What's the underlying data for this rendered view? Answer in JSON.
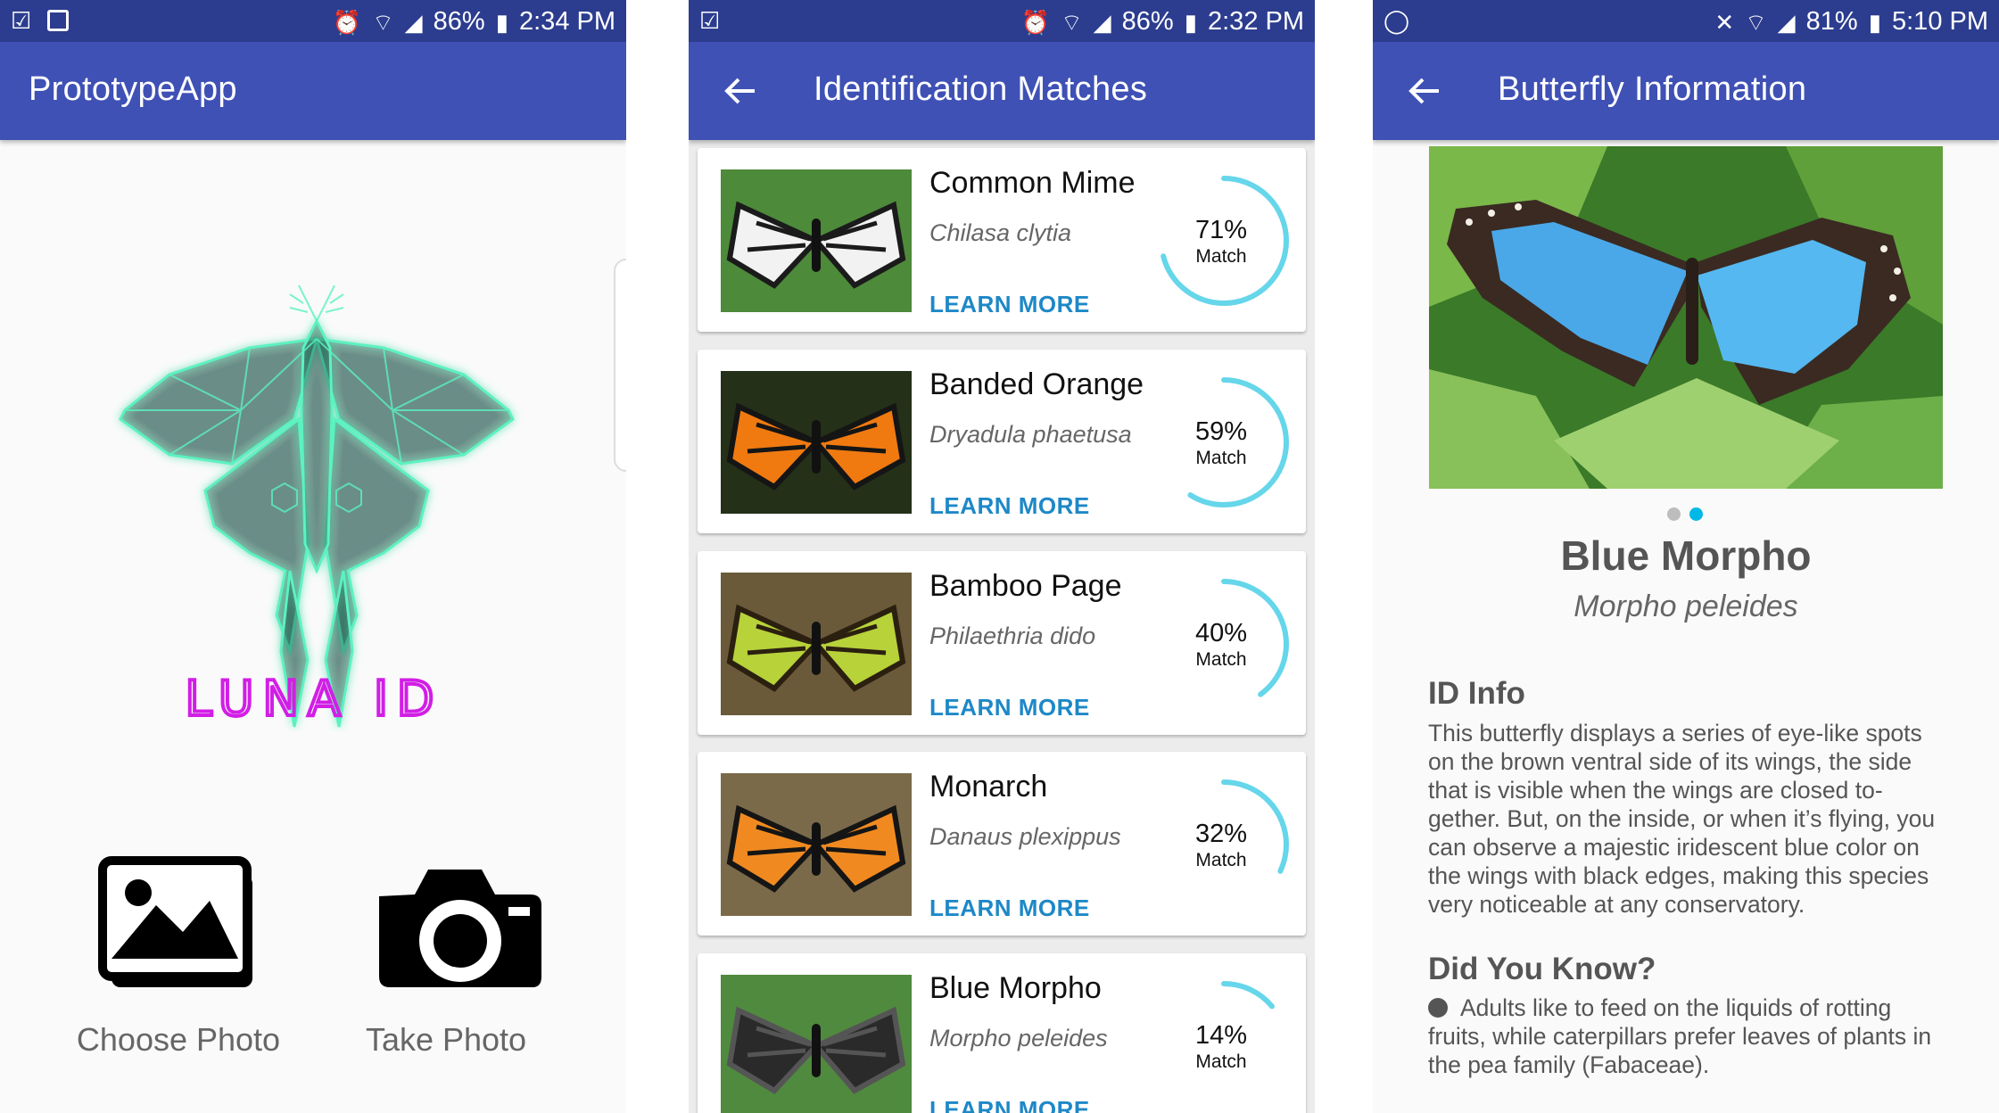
{
  "colors": {
    "statusbar": "#2c3d8f",
    "appbar": "#3f51b5",
    "accent": "#1e88c7",
    "ring": "#66d6ea",
    "logo": "#5cf2c0",
    "logo_text": "#d21ee6"
  },
  "panel1": {
    "status": {
      "battery": "86%",
      "time": "2:34 PM"
    },
    "title": "PrototypeApp",
    "logo_text": "LUNA ID",
    "choose_label": "Choose Photo",
    "take_label": "Take Photo"
  },
  "panel2": {
    "status": {
      "battery": "86%",
      "time": "2:32 PM"
    },
    "title": "Identification Matches",
    "matches": [
      {
        "name": "Common Mime",
        "scientific": "Chilasa clytia",
        "percent": "71%",
        "percent_value": 0.71,
        "match": "Match",
        "learn": "LEARN MORE"
      },
      {
        "name": "Banded Orange",
        "scientific": "Dryadula phaetusa",
        "percent": "59%",
        "percent_value": 0.59,
        "match": "Match",
        "learn": "LEARN MORE"
      },
      {
        "name": "Bamboo Page",
        "scientific": "Philaethria dido",
        "percent": "40%",
        "percent_value": 0.4,
        "match": "Match",
        "learn": "LEARN MORE"
      },
      {
        "name": "Monarch",
        "scientific": "Danaus plexippus",
        "percent": "32%",
        "percent_value": 0.32,
        "match": "Match",
        "learn": "LEARN MORE"
      },
      {
        "name": "Blue Morpho",
        "scientific": "Morpho peleides",
        "percent": "14%",
        "percent_value": 0.14,
        "match": "Match",
        "learn": "LEARN MORE"
      }
    ]
  },
  "panel3": {
    "status": {
      "battery": "81%",
      "time": "5:10 PM"
    },
    "title": "Butterfly Information",
    "name": "Blue Morpho",
    "scientific": "Morpho peleides",
    "id_info_heading": "ID Info",
    "id_info_text": "This butterfly displays a series of eye-like spots on the brown ventral side of its wings, the side that is visible when the wings are closed to-gether. But, on the inside, or when it’s flying, you can observe a majestic iridescent blue color on the wings with black edges, making this species very noticeable at any conservatory.",
    "did_you_know_heading": "Did You Know?",
    "facts": [
      "Adults like to feed on the liquids of rotting fruits, while caterpillars prefer leaves of plants in the pea family (Fabaceae)."
    ]
  }
}
